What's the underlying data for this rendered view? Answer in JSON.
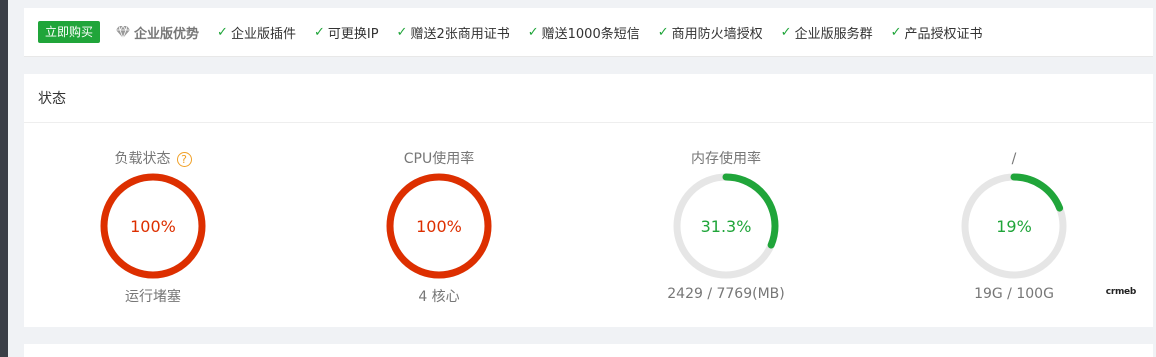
{
  "promo": {
    "buy_label": "立即购买",
    "edition_title": "企业版优势",
    "features": [
      "企业版插件",
      "可更换IP",
      "赠送2张商用证书",
      "赠送1000条短信",
      "商用防火墙授权",
      "企业版服务群",
      "产品授权证书"
    ]
  },
  "status": {
    "title": "状态",
    "gauges": [
      {
        "title": "负载状态",
        "value": "100%",
        "percent": 100,
        "sub": "运行堵塞",
        "color": "#dd2f00",
        "help": "?"
      },
      {
        "title": "CPU使用率",
        "value": "100%",
        "percent": 100,
        "sub": "4 核心",
        "color": "#dd2f00"
      },
      {
        "title": "内存使用率",
        "value": "31.3%",
        "percent": 31.3,
        "sub": "2429 / 7769(MB)",
        "color": "#20a53a"
      },
      {
        "title": "/",
        "value": "19%",
        "percent": 19,
        "sub": "19G / 100G",
        "color": "#20a53a"
      }
    ]
  },
  "brand_mark": "crmeb",
  "colors": {
    "accent": "#20a53a",
    "danger": "#dd2f00",
    "warning": "#f0a026",
    "track": "#e6e6e6"
  }
}
